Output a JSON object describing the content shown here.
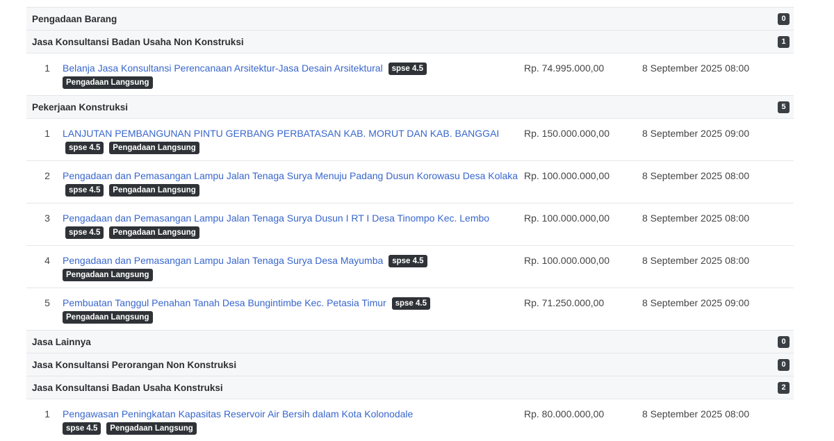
{
  "badges": {
    "spse": "spse 4.5",
    "method": "Pengadaan Langsung"
  },
  "categories": [
    {
      "name": "Pengadaan Barang",
      "count": "0"
    },
    {
      "name": "Jasa Konsultansi Badan Usaha Non Konstruksi",
      "count": "1"
    },
    {
      "name": "Pekerjaan Konstruksi",
      "count": "5"
    },
    {
      "name": "Jasa Lainnya",
      "count": "0"
    },
    {
      "name": "Jasa Konsultansi Perorangan Non Konstruksi",
      "count": "0"
    },
    {
      "name": "Jasa Konsultansi Badan Usaha Konstruksi",
      "count": "2"
    }
  ],
  "items": [
    {
      "no": "1",
      "title": "Belanja Jasa Konsultansi Perencanaan Arsitektur-Jasa Desain Arsitektural",
      "price": "Rp. 74.995.000,00",
      "date": "8 September 2025 08:00"
    },
    {
      "no": "1",
      "title": "LANJUTAN PEMBANGUNAN PINTU GERBANG PERBATASAN KAB. MORUT DAN KAB. BANGGAI",
      "price": "Rp. 150.000.000,00",
      "date": "8 September 2025 09:00"
    },
    {
      "no": "2",
      "title": "Pengadaan dan Pemasangan Lampu Jalan Tenaga Surya Menuju Padang Dusun Korowasu Desa Kolaka",
      "price": "Rp. 100.000.000,00",
      "date": "8 September 2025 08:00"
    },
    {
      "no": "3",
      "title": "Pengadaan dan Pemasangan Lampu Jalan Tenaga Surya Dusun I RT I Desa Tinompo Kec. Lembo",
      "price": "Rp. 100.000.000,00",
      "date": "8 September 2025 08:00"
    },
    {
      "no": "4",
      "title": "Pengadaan dan Pemasangan Lampu Jalan Tenaga Surya Desa Mayumba",
      "price": "Rp. 100.000.000,00",
      "date": "8 September 2025 08:00"
    },
    {
      "no": "5",
      "title": "Pembuatan Tanggul Penahan Tanah Desa Bungintimbe Kec. Petasia Timur",
      "price": "Rp. 71.250.000,00",
      "date": "8 September 2025 09:00"
    },
    {
      "no": "1",
      "title": "Pengawasan Peningkatan Kapasitas Reservoir Air Bersih dalam Kota Kolonodale",
      "price": "Rp. 80.000.000,00",
      "date": "8 September 2025 08:00"
    }
  ]
}
